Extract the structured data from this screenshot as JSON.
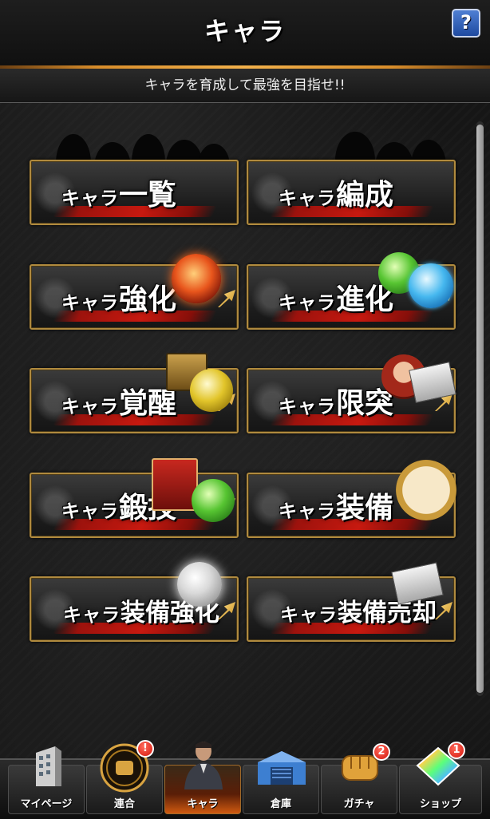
{
  "header": {
    "title": "キャラ",
    "help_label": "?",
    "subtitle": "キャラを育成して最強を目指せ!!"
  },
  "menu": {
    "prefix": "キャラ",
    "items": [
      {
        "label": "一覧"
      },
      {
        "label": "編成"
      },
      {
        "label": "強化"
      },
      {
        "label": "進化"
      },
      {
        "label": "覚醒"
      },
      {
        "label": "限突"
      },
      {
        "label": "鍛技"
      },
      {
        "label": "装備"
      },
      {
        "label": "装備強化"
      },
      {
        "label": "装備売却"
      }
    ]
  },
  "nav": {
    "tabs": [
      {
        "label": "マイページ",
        "icon": "building-icon"
      },
      {
        "label": "連合",
        "icon": "fist-emblem-icon",
        "badge": "!"
      },
      {
        "label": "キャラ",
        "icon": "character-icon",
        "active": true
      },
      {
        "label": "倉庫",
        "icon": "warehouse-icon"
      },
      {
        "label": "ガチャ",
        "icon": "fist-icon",
        "badge": "2"
      },
      {
        "label": "ショップ",
        "icon": "rainbow-gem-icon",
        "badge": "1"
      }
    ]
  },
  "colors": {
    "accent_gold": "#d88d2b",
    "badge_red": "#d4160c",
    "splash_red": "#d0190f"
  }
}
